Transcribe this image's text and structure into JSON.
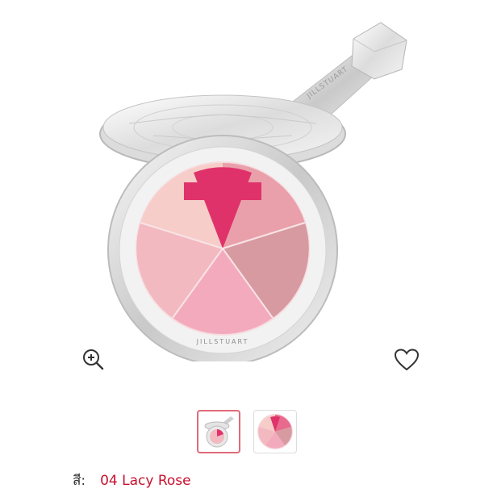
{
  "product": {
    "brand_text": "JILLSTUART",
    "image_alt": "JILL STUART blush compact 04 Lacy Rose"
  },
  "actions": {
    "zoom_icon": "zoom-in-icon",
    "wishlist_icon": "heart-icon"
  },
  "thumbnails": [
    {
      "name": "compact-closed-lid",
      "selected": true
    },
    {
      "name": "pan-closeup",
      "selected": false
    }
  ],
  "variant": {
    "label": "สี:",
    "value": "04 Lacy Rose"
  },
  "colors": {
    "accent": "#c8102e",
    "thumb_border_selected": "#e06a7a",
    "petal_light": "#f6cdc9",
    "petal_rose": "#e86a8c",
    "petal_pink": "#f4aabd",
    "petal_mauve": "#d89aa1",
    "petal_deep": "#e0326a"
  }
}
